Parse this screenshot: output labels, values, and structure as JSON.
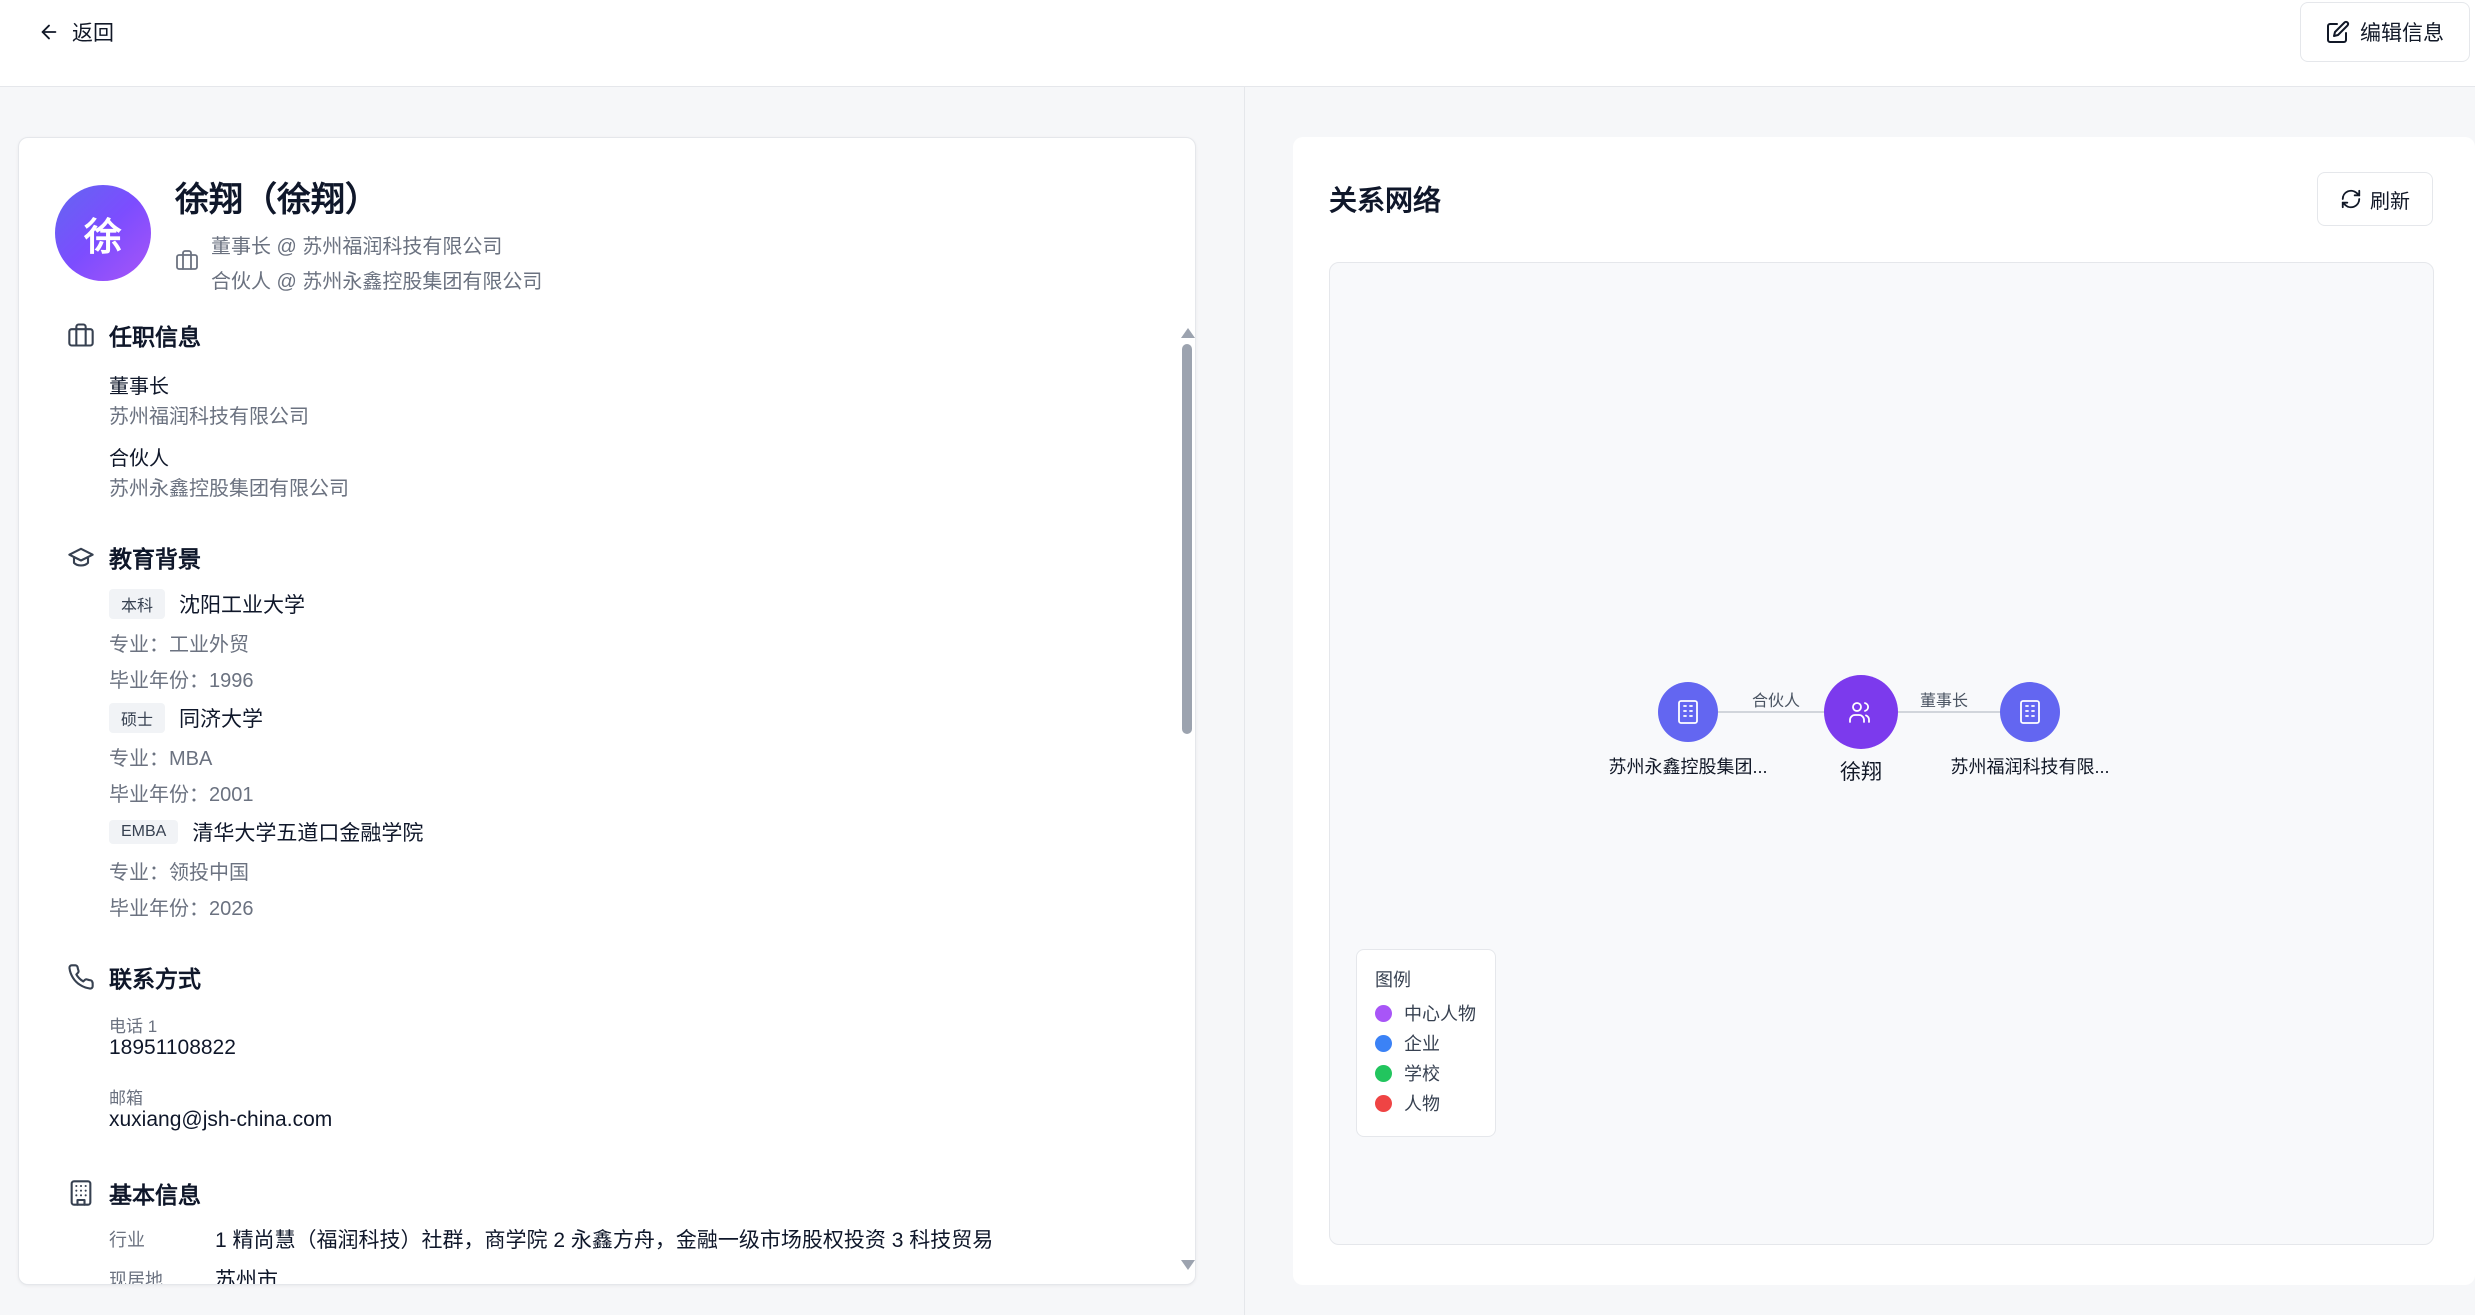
{
  "topbar": {
    "back_label": "返回",
    "edit_label": "编辑信息"
  },
  "profile": {
    "avatar_char": "徐",
    "name": "徐翔（徐翔）",
    "positions": [
      "董事长 @ 苏州福润科技有限公司",
      "合伙人 @ 苏州永鑫控股集团有限公司"
    ]
  },
  "sections": {
    "job": {
      "title": "任职信息",
      "items": [
        {
          "role": "董事长",
          "org": "苏州福润科技有限公司"
        },
        {
          "role": "合伙人",
          "org": "苏州永鑫控股集团有限公司"
        }
      ]
    },
    "education": {
      "title": "教育背景",
      "items": [
        {
          "degree": "本科",
          "school": "沈阳工业大学",
          "major": "专业：工业外贸",
          "year": "毕业年份：1996"
        },
        {
          "degree": "硕士",
          "school": "同济大学",
          "major": "专业：MBA",
          "year": "毕业年份：2001"
        },
        {
          "degree": "EMBA",
          "school": "清华大学五道口金融学院",
          "major": "专业：领投中国",
          "year": "毕业年份：2026"
        }
      ]
    },
    "contact": {
      "title": "联系方式",
      "phone_label": "电话 1",
      "phone": "18951108822",
      "email_label": "邮箱",
      "email": "xuxiang@jsh-china.com"
    },
    "basic": {
      "title": "基本信息",
      "industry_label": "行业",
      "industry": "1 精尚慧（福润科技）社群，商学院 2 永鑫方舟，金融一级市场股权投资 3 科技贸易",
      "location_label": "现居地",
      "location": "苏州市"
    }
  },
  "network": {
    "title": "关系网络",
    "refresh_label": "刷新",
    "nodes": [
      {
        "name": "苏州永鑫控股集团...",
        "type": "企业",
        "color": "#6366f1"
      },
      {
        "name": "徐翔",
        "type": "中心人物",
        "color": "#7c3aed"
      },
      {
        "name": "苏州福润科技有限...",
        "type": "企业",
        "color": "#6366f1"
      }
    ],
    "edges": [
      {
        "label": "合伙人"
      },
      {
        "label": "董事长"
      }
    ],
    "legend": {
      "title": "图例",
      "items": [
        {
          "label": "中心人物",
          "color": "#a855f7"
        },
        {
          "label": "企业",
          "color": "#3b82f6"
        },
        {
          "label": "学校",
          "color": "#22c55e"
        },
        {
          "label": "人物",
          "color": "#ef4444"
        }
      ]
    }
  }
}
